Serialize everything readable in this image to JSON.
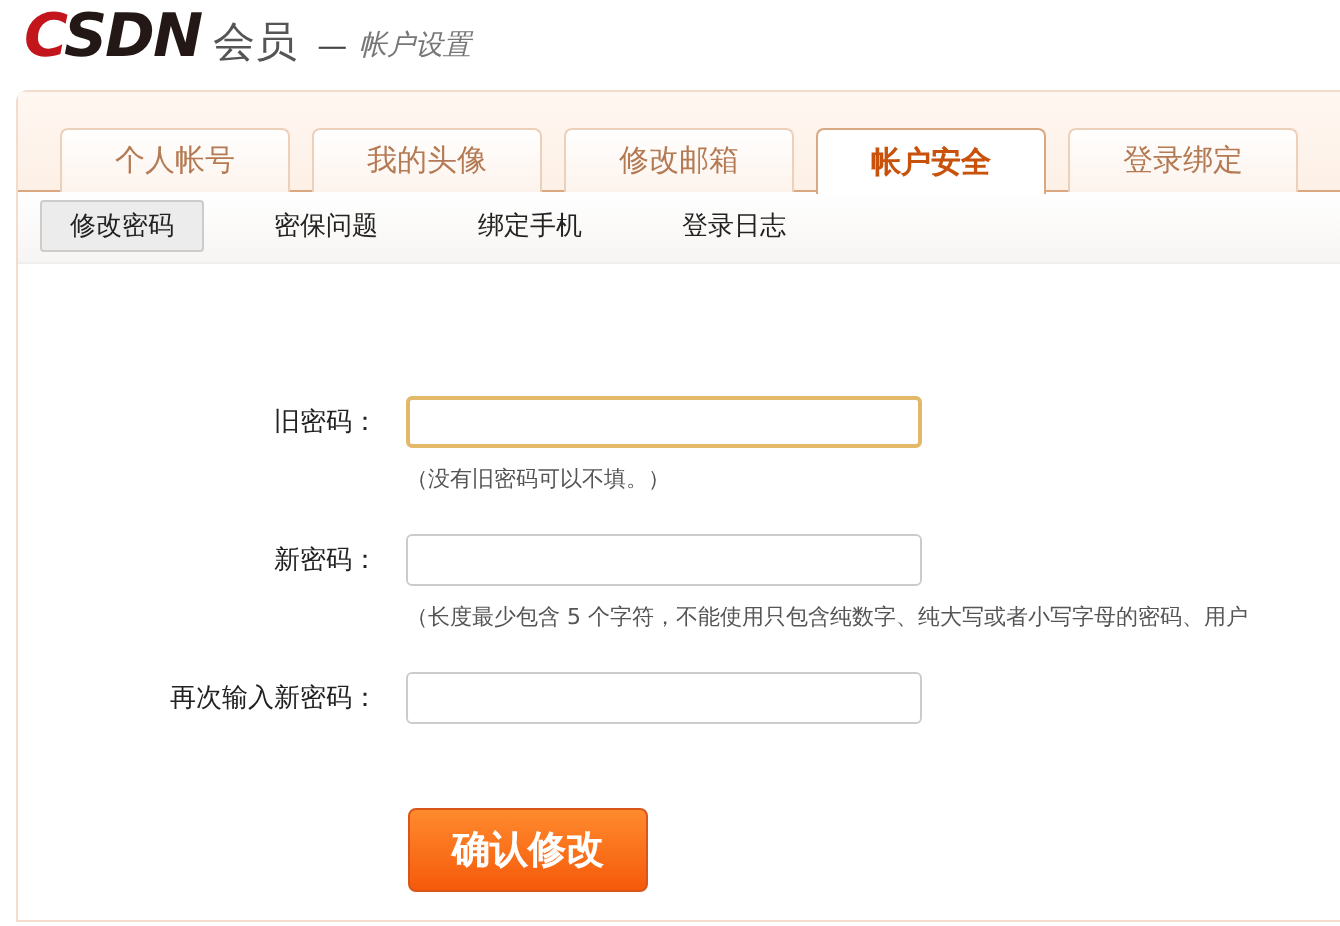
{
  "header": {
    "logo": "CSDN",
    "product": "会员",
    "separator": "—",
    "section": "帐户设置"
  },
  "tabs": [
    {
      "label": "个人帐号",
      "selected": false
    },
    {
      "label": "我的头像",
      "selected": false
    },
    {
      "label": "修改邮箱",
      "selected": false
    },
    {
      "label": "帐户安全",
      "selected": true
    },
    {
      "label": "登录绑定",
      "selected": false
    }
  ],
  "subtabs": [
    {
      "label": "修改密码",
      "selected": true
    },
    {
      "label": "密保问题",
      "selected": false
    },
    {
      "label": "绑定手机",
      "selected": false
    },
    {
      "label": "登录日志",
      "selected": false
    }
  ],
  "fields": [
    {
      "label": "旧密码：",
      "focused": true,
      "hint": "（没有旧密码可以不填。）"
    },
    {
      "label": "新密码：",
      "focused": false,
      "hint": "（长度最少包含 5 个字符，不能使用只包含纯数字、纯大写或者小写字母的密码、用户"
    },
    {
      "label": "再次输入新密码：",
      "focused": false
    }
  ],
  "submit_button": "确认修改"
}
